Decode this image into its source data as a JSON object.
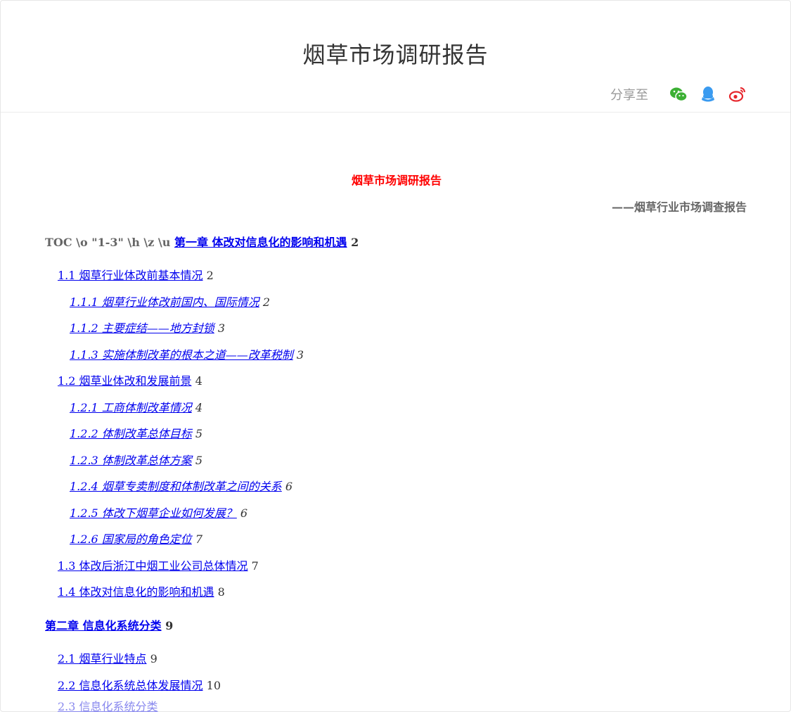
{
  "header": {
    "title": "烟草市场调研报告",
    "share_label": "分享至",
    "share_icons": [
      "wechat-icon",
      "qq-icon",
      "weibo-icon"
    ]
  },
  "document": {
    "title": "烟草市场调研报告",
    "subtitle": "——烟草行业市场调查报告",
    "toc_prefix": "TOC \\o \"1-3\" \\h \\z \\u",
    "entries": [
      {
        "level": 1,
        "label": "第一章 体改对信息化的影响和机遇",
        "page": "2"
      },
      {
        "level": 2,
        "label": "1.1 烟草行业体改前基本情况",
        "page": "2"
      },
      {
        "level": 3,
        "label": "1.1.1 烟草行业体改前国内、国际情况",
        "page": "2"
      },
      {
        "level": 3,
        "label": "1.1.2 主要症结——地方封锁",
        "page": "3"
      },
      {
        "level": 3,
        "label": "1.1.3 实施体制改革的根本之道——改革税制",
        "page": "3"
      },
      {
        "level": 2,
        "label": "1.2 烟草业体改和发展前景",
        "page": "4"
      },
      {
        "level": 3,
        "label": "1.2.1 工商体制改革情况",
        "page": "4"
      },
      {
        "level": 3,
        "label": "1.2.2 体制改革总体目标",
        "page": "5"
      },
      {
        "level": 3,
        "label": "1.2.3 体制改革总体方案",
        "page": "5"
      },
      {
        "level": 3,
        "label": "1.2.4 烟草专卖制度和体制改革之间的关系",
        "page": "6"
      },
      {
        "level": 3,
        "label": "1.2.5 体改下烟草企业如何发展？",
        "page": "6"
      },
      {
        "level": 3,
        "label": "1.2.6 国家局的角色定位",
        "page": "7"
      },
      {
        "level": 2,
        "label": "1.3 体改后浙江中烟工业公司总体情况",
        "page": "7"
      },
      {
        "level": 2,
        "label": "1.4 体改对信息化的影响和机遇",
        "page": "8"
      },
      {
        "level": 1,
        "label": "第二章 信息化系统分类",
        "page": "9"
      },
      {
        "level": 2,
        "label": "2.1 烟草行业特点",
        "page": "9"
      },
      {
        "level": 2,
        "label": "2.2 信息化系统总体发展情况",
        "page": "10"
      },
      {
        "level": 2,
        "label": "2.3 信息化系统分类",
        "page": ""
      }
    ]
  },
  "colors": {
    "title_red": "#ff0000",
    "link_blue": "#0000ee",
    "wechat_green": "#3cb034",
    "qq_blue": "#3a9bf0",
    "weibo_red": "#e6262c"
  }
}
